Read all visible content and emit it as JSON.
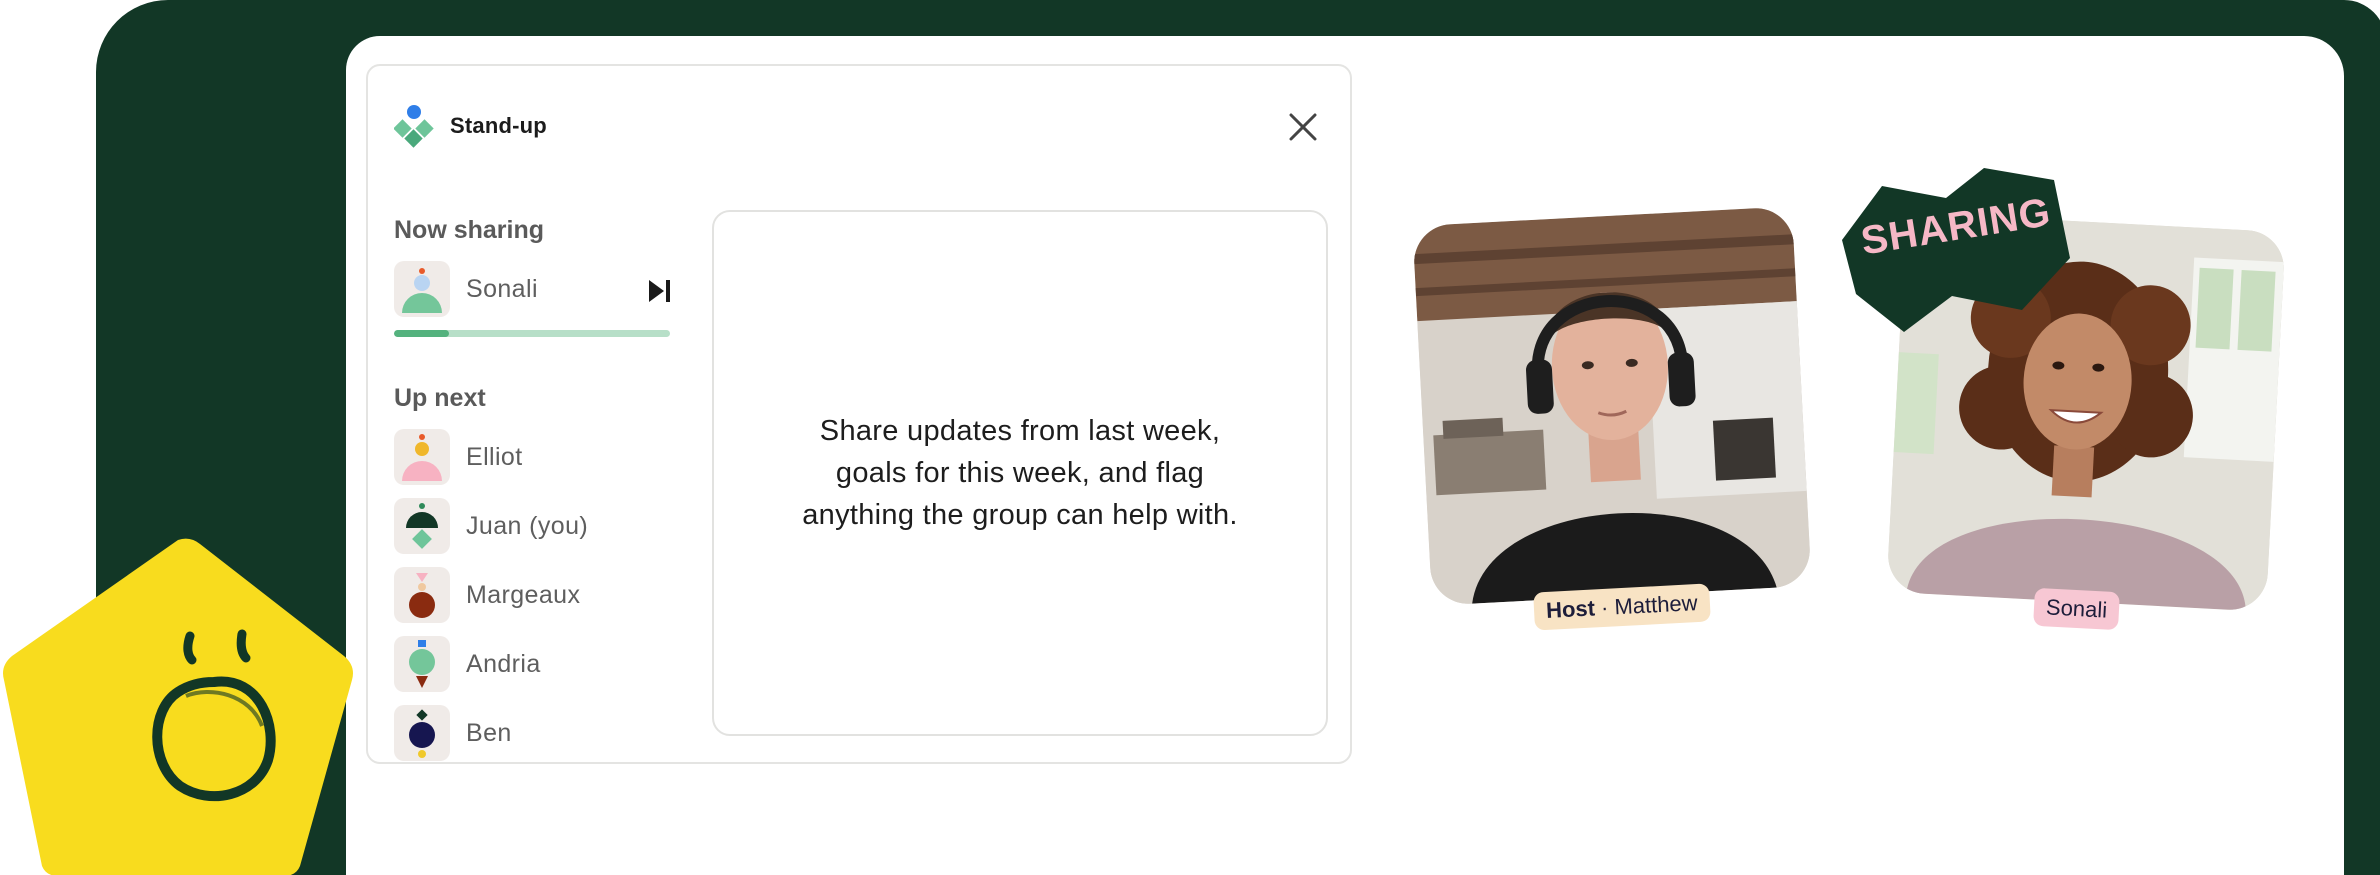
{
  "panel": {
    "title": "Stand-up",
    "close_icon": "close-icon",
    "logo_icon": "diamond-cluster-logo-icon"
  },
  "now_sharing": {
    "heading": "Now sharing",
    "person": {
      "name": "Sonali",
      "avatar": "avatar-sonali"
    },
    "skip_icon": "skip-next-icon",
    "progress": 0.2
  },
  "up_next": {
    "heading": "Up next",
    "people": [
      {
        "name": "Elliot",
        "avatar": "avatar-elliot"
      },
      {
        "name": "Juan (you)",
        "avatar": "avatar-juan"
      },
      {
        "name": "Margeaux",
        "avatar": "avatar-margeaux"
      },
      {
        "name": "Andria",
        "avatar": "avatar-andria"
      },
      {
        "name": "Ben",
        "avatar": "avatar-ben"
      }
    ]
  },
  "prompt": {
    "text": "Share updates from last week, goals for this week, and flag anything the group can help with."
  },
  "videos": {
    "host": {
      "role_label": "Host",
      "separator": "·",
      "name": "Matthew"
    },
    "sharing": {
      "badge": "SHARING",
      "name": "Sonali"
    }
  },
  "colors": {
    "frame_green": "#123726",
    "progress_fill": "#54b27e",
    "progress_track": "#b7dfc8",
    "mascot_yellow": "#f8dc1e",
    "host_tag": "#f8e3c4",
    "sonali_tag": "#f7c7d3",
    "sharing_text": "#f6b8c6"
  }
}
